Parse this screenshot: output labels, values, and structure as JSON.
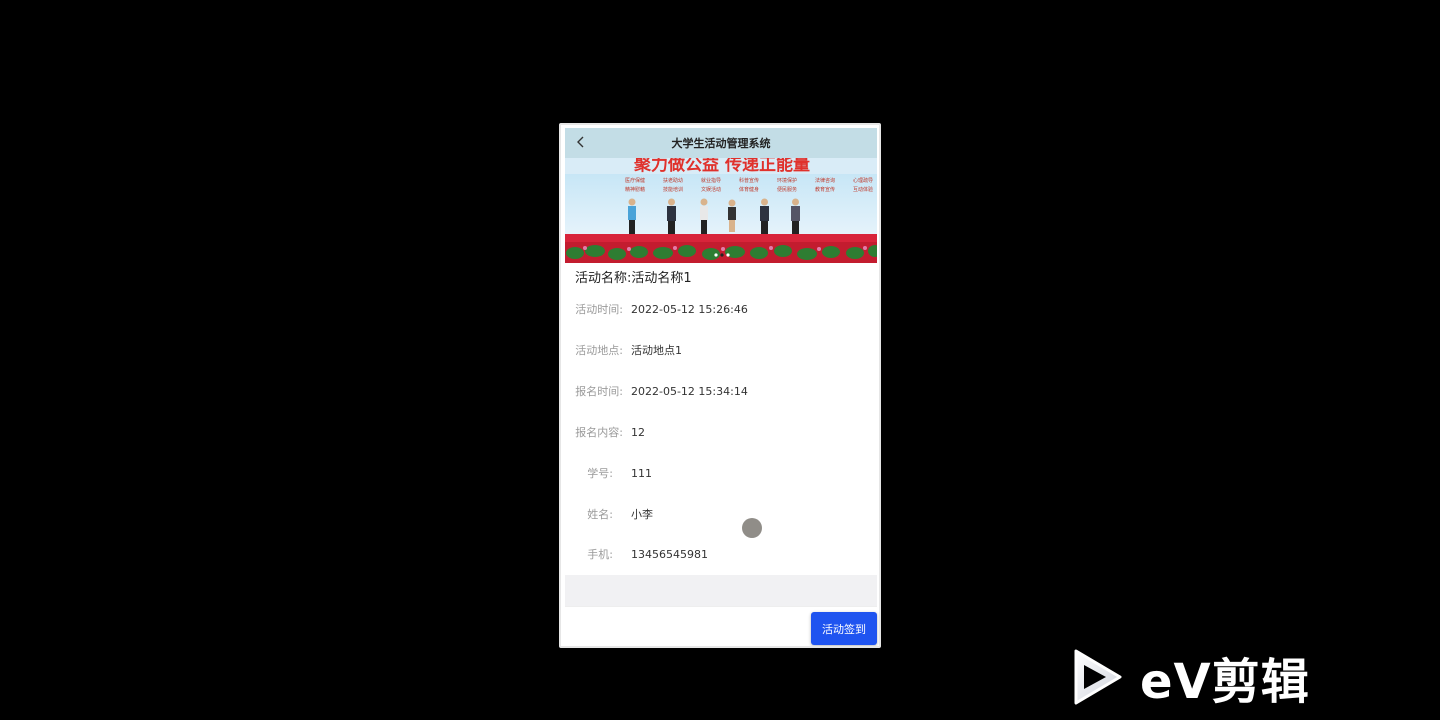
{
  "app": {
    "title": "大学生活动管理系统",
    "back_icon": "chevron-left-icon"
  },
  "banner": {
    "headline": "聚力做公益 传递正能量",
    "tags_row1": [
      "医疗保健",
      "扶老助幼",
      "就业指导",
      "科普宣传",
      "环境保护",
      "法律咨询",
      "心理疏导"
    ],
    "tags_row2": [
      "精神慰藉",
      "技能培训",
      "文娱活动",
      "体育健身",
      "便民服务",
      "教育宣传",
      "互动体验"
    ]
  },
  "activity": {
    "name_label": "活动名称:",
    "name_value": "活动名称1",
    "fields": [
      {
        "label": "活动时间:",
        "value": "2022-05-12 15:26:46"
      },
      {
        "label": "活动地点:",
        "value": "活动地点1"
      },
      {
        "label": "报名时间:",
        "value": "2022-05-12 15:34:14"
      },
      {
        "label": "报名内容:",
        "value": "12"
      },
      {
        "label": "学号:",
        "value": "111"
      },
      {
        "label": "姓名:",
        "value": "小李"
      },
      {
        "label": "手机:",
        "value": "13456545981"
      }
    ]
  },
  "footer": {
    "signin_label": "活动签到"
  },
  "watermark": {
    "text": "eV剪辑",
    "icon": "play-icon"
  },
  "colors": {
    "titlebar": "#c3dde6",
    "primary_button": "#1f54f0",
    "background": "#000000"
  }
}
